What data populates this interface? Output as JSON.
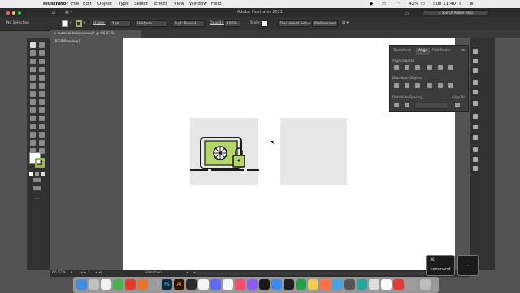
{
  "menubar": {
    "app": "Illustrator",
    "items": [
      "File",
      "Edit",
      "Object",
      "Type",
      "Select",
      "Effect",
      "View",
      "Window",
      "Help"
    ],
    "battery": "42%",
    "clock": "Sun 11:40"
  },
  "appbar": {
    "title": "Adobe Illustrator 2021",
    "search_placeholder": "Search Adobe Help"
  },
  "controlbar": {
    "selection": "No Selection",
    "stroke_label": "Stroke:",
    "stroke_value": "1 pt",
    "profile": "Uniform",
    "brush": "3 pt. Round",
    "opacity_label": "Opacity:",
    "opacity_value": "100%",
    "style_label": "Style:",
    "document_setup": "Document Setup",
    "preferences": "Preferences",
    "fill_color": "#ffffff",
    "stroke_color": "#97b457"
  },
  "document": {
    "tab": "tutorial-business.ai* @ 66.67% (RGB/Preview)"
  },
  "align_panel": {
    "tabs": [
      "Transform",
      "Align",
      "Pathfinder"
    ],
    "active_tab": "Align",
    "align_objects": "Align Objects:",
    "distribute_objects": "Distribute Objects:",
    "distribute_spacing": "Distribute Spacing:",
    "align_to": "Align To:"
  },
  "status": {
    "zoom": "66.67%",
    "artboard": "1",
    "tool": "Selection"
  },
  "keys": {
    "command_symbol": "⌘",
    "command_label": "command",
    "minus": "–"
  },
  "artwork": {
    "stroke": "#1a1a1a",
    "accent": "#b3d66b",
    "tile": "#e6e6e6"
  }
}
